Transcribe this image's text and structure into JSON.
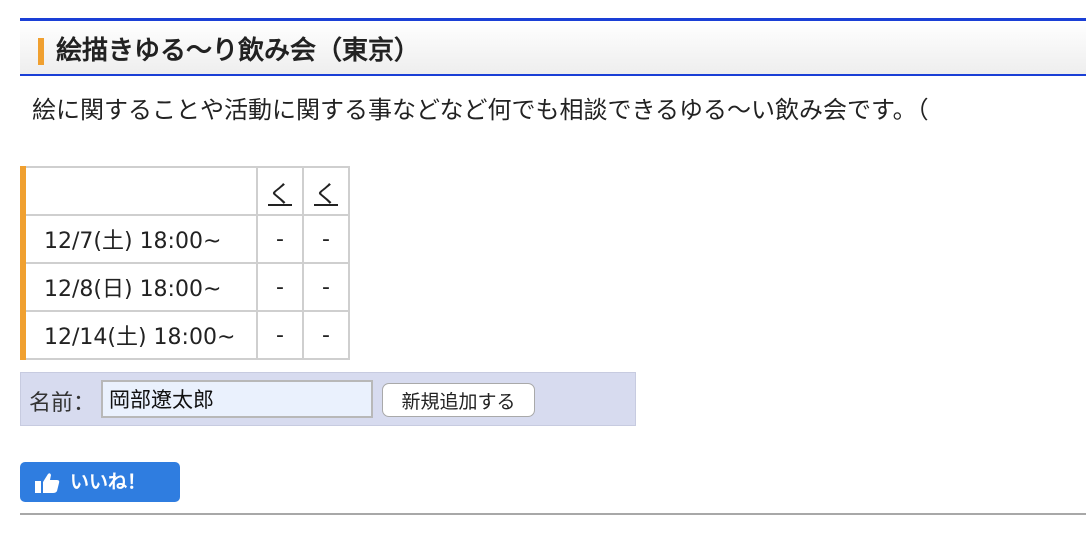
{
  "event": {
    "title": "絵描きゆる〜り飲み会（東京）",
    "description": "絵に関することや活動に関する事などなど何でも相談できるゆる〜い飲み会です。（"
  },
  "schedule": {
    "columns": [
      "",
      "く",
      "く"
    ],
    "rows": [
      {
        "date": "12/7(土) 18:00~",
        "marks": [
          "-",
          "-"
        ]
      },
      {
        "date": "12/8(日) 18:00~",
        "marks": [
          "-",
          "-"
        ]
      },
      {
        "date": "12/14(土) 18:00~",
        "marks": [
          "-",
          "-"
        ]
      }
    ]
  },
  "form": {
    "name_label": "名前：",
    "name_value": "岡部遼太郎",
    "add_button_label": "新規追加する"
  },
  "like": {
    "label": "いいね！"
  },
  "colors": {
    "accent_blue": "#1a3fd6",
    "accent_orange": "#f0a030",
    "like_blue": "#2f7de0",
    "form_background": "#d7dbef"
  }
}
